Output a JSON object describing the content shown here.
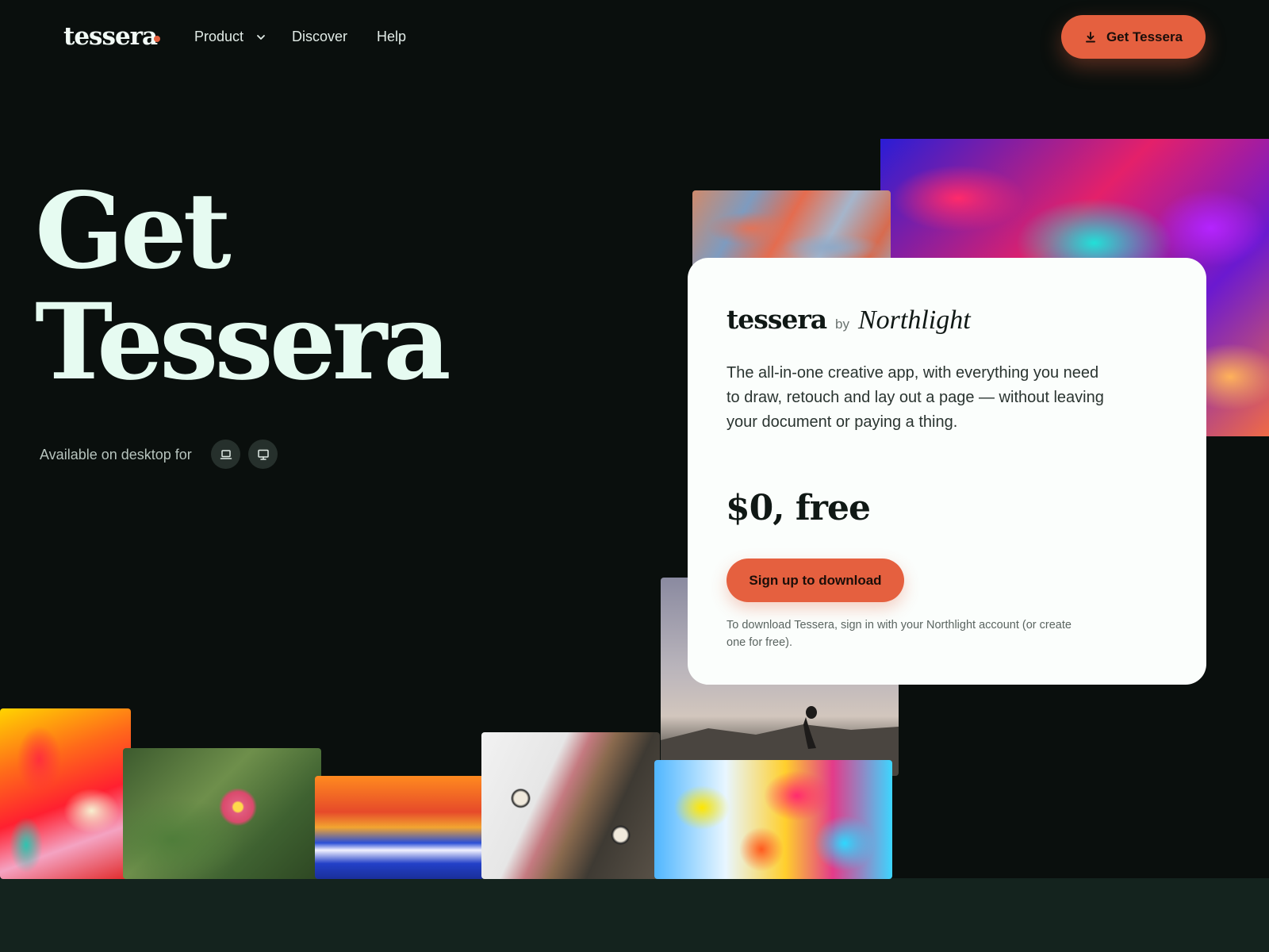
{
  "nav": {
    "logo": "tessera",
    "links": [
      {
        "label": "Product"
      },
      {
        "label": "Discover"
      },
      {
        "label": "Help"
      }
    ],
    "cta_label": "Get Tessera"
  },
  "hero": {
    "title_line1": "Get",
    "title_line2": "Tessera",
    "available_text": "Available on desktop for",
    "platforms": [
      "laptop-icon",
      "desktop-icon"
    ]
  },
  "card": {
    "brand": "tessera",
    "by": "by",
    "vendor": "Northlight",
    "description": "The all-in-one creative app, with everything you need to draw, retouch and lay out a page — without leaving your document or paying a thing.",
    "price": "$0, free",
    "cta_label": "Sign up to download",
    "note": "To download Tessera, sign in with your Northlight account (or create one for free)."
  },
  "colors": {
    "background": "#0a0f0d",
    "accent": "#e5603f",
    "card": "#fbfefc",
    "headline": "#e6fbf1"
  }
}
